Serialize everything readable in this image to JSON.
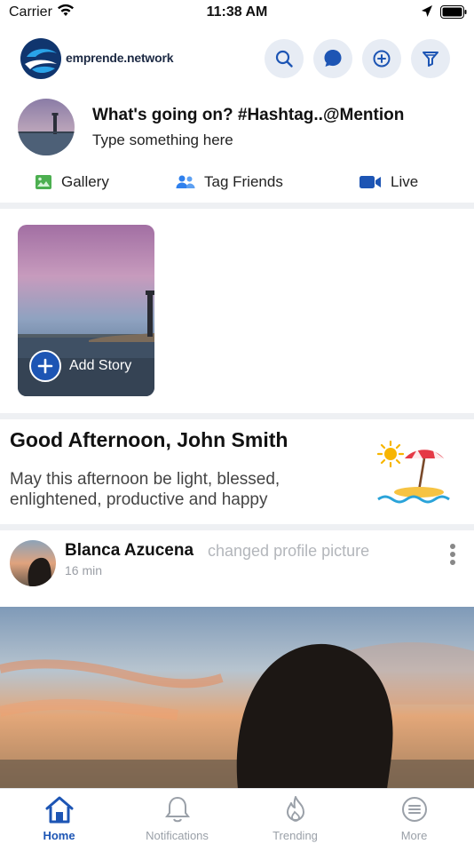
{
  "status_bar": {
    "carrier": "Carrier",
    "time": "11:38 AM"
  },
  "header": {
    "brand": "emprende.network",
    "buttons": [
      "search-icon",
      "chat-icon",
      "add-circle-icon",
      "filter-icon"
    ]
  },
  "composer": {
    "title": "What's going on? #Hashtag..@Mention",
    "subtitle": "Type something here",
    "actions": [
      {
        "label": "Gallery",
        "icon": "gallery-icon",
        "color": "#4caf50"
      },
      {
        "label": "Tag Friends",
        "icon": "friends-icon",
        "color": "#2f80ed"
      },
      {
        "label": "Live",
        "icon": "video-icon",
        "color": "#1d55b4"
      }
    ]
  },
  "stories": {
    "add_label": "Add Story"
  },
  "greeting": {
    "title": "Good Afternoon, John Smith",
    "message": "May this afternoon be light, blessed, enlightened, productive and happy"
  },
  "post": {
    "author": "Blanca Azucena",
    "action": "changed profile picture",
    "time": "16 min"
  },
  "tabs": [
    {
      "label": "Home",
      "icon": "home-icon",
      "active": true
    },
    {
      "label": "Notifications",
      "icon": "bell-icon",
      "active": false
    },
    {
      "label": "Trending",
      "icon": "flame-icon",
      "active": false
    },
    {
      "label": "More",
      "icon": "more-icon",
      "active": false
    }
  ],
  "colors": {
    "accent": "#1d55b4",
    "button_bg": "#e7ecf4",
    "divider": "#eef0f3"
  }
}
